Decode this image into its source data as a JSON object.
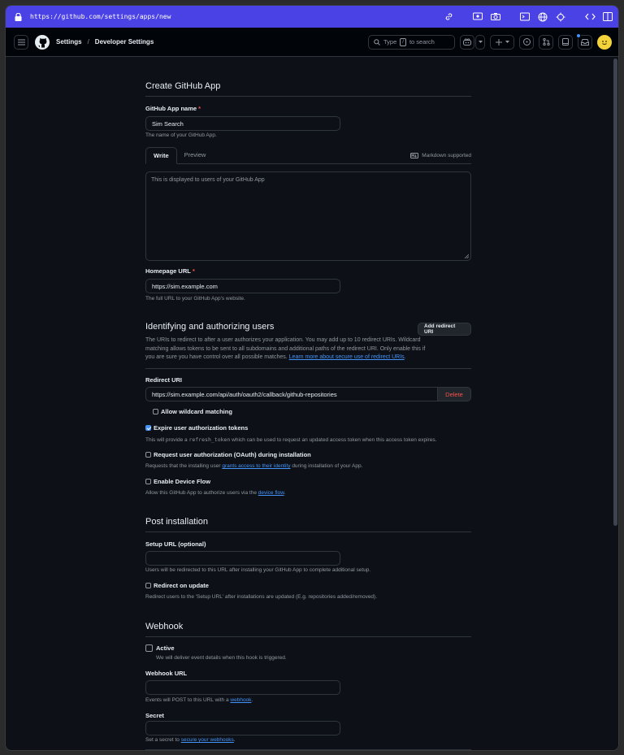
{
  "browser": {
    "url": "https://github.com/settings/apps/new"
  },
  "header": {
    "breadcrumb_1": "Settings",
    "breadcrumb_sep": "/",
    "breadcrumb_2": "Developer Settings",
    "search_prefix": "Type",
    "search_key": "/",
    "search_suffix": "to search"
  },
  "form": {
    "title": "Create GitHub App",
    "name_label": "GitHub App name",
    "required_mark": "*",
    "name_value": "Sim Search",
    "name_note": "The name of your GitHub App.",
    "tab_write": "Write",
    "tab_preview": "Preview",
    "markdown": "Markdown supported",
    "description_placeholder": "This is displayed to users of your GitHub App",
    "homepage_label": "Homepage URL",
    "homepage_value": "https://sim.example.com",
    "homepage_note": "The full URL to your GitHub App's website."
  },
  "identify": {
    "title": "Identifying and authorizing users",
    "add_button": "Add redirect URI",
    "desc_line1": "The URIs to redirect to after a user authorizes your application. You may add up to 10 redirect URIs. Wildcard",
    "desc_line2": "matching allows tokens to be sent to all subdomains and additional paths of the redirect URI. Only enable this if",
    "desc_line3": "you are sure you have control over all possible matches.",
    "desc_link": "Learn more about secure use of redirect URIs",
    "desc_end": ".",
    "redirect_label": "Redirect URI",
    "redirect_value": "https://sim.example.com/api/auth/oauth2/callback/github-repositories",
    "delete": "Delete",
    "wildcard": "Allow wildcard matching",
    "expire_label": "Expire user authorization tokens",
    "expire_note_a": "This will provide a",
    "expire_note_code": "refresh_token",
    "expire_note_b": "which can be used to request an updated access token when this access token expires.",
    "oauth_label": "Request user authorization (OAuth) during installation",
    "oauth_note_a": "Requests that the installing user",
    "oauth_note_link": "grants access to their identity",
    "oauth_note_b": "during installation of your App.",
    "device_label": "Enable Device Flow",
    "device_note_a": "Allow this GitHub App to authorize users via the",
    "device_note_link": "device flow",
    "device_note_b": "."
  },
  "post": {
    "title": "Post installation",
    "setup_label": "Setup URL (optional)",
    "setup_note": "Users will be redirected to this URL after installing your GitHub App to complete additional setup.",
    "redirect_update": "Redirect on update",
    "redirect_update_note": "Redirect users to the 'Setup URL' after installations are updated (E.g. repositories added/removed)."
  },
  "webhook": {
    "title": "Webhook",
    "active": "Active",
    "active_note": "We will deliver event details when this hook is triggered.",
    "url_label": "Webhook URL",
    "url_note_a": "Events will POST to this URL with a",
    "url_note_link": "webhook",
    "url_note_b": ".",
    "secret_label": "Secret",
    "secret_note_a": "Set a secret to",
    "secret_note_link": "secure your webhooks",
    "secret_note_b": "."
  },
  "state": {
    "wildcard_checked": false,
    "expire_checked": true,
    "oauth_checked": false,
    "device_checked": false,
    "redirect_update_checked": false,
    "active_checked": false
  },
  "colors": {
    "browser_bar": "#4b42e6",
    "background": "#0d1117",
    "accent_link": "#4493f8",
    "danger": "#f85149",
    "avatar": "#f3d23a"
  }
}
